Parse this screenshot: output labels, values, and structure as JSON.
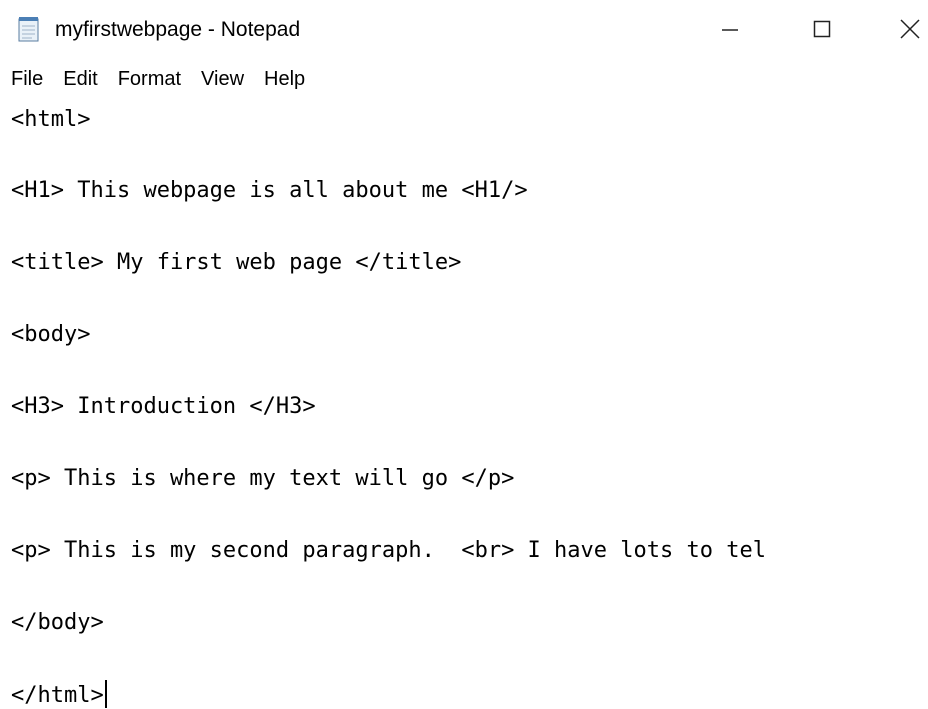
{
  "window": {
    "title": "myfirstwebpage - Notepad",
    "app_icon": "notepad-icon",
    "controls": {
      "minimize_icon": "minimize-icon",
      "maximize_icon": "maximize-icon",
      "close_icon": "close-icon"
    }
  },
  "menu": {
    "items": [
      {
        "label": "File"
      },
      {
        "label": "Edit"
      },
      {
        "label": "Format"
      },
      {
        "label": "View"
      },
      {
        "label": "Help"
      }
    ]
  },
  "editor": {
    "lines": [
      "<html>",
      "<H1> This webpage is all about me <H1/>",
      "<title> My first web page </title>",
      "<body>",
      "<H3> Introduction </H3>",
      "<p> This is where my text will go </p>",
      "<p> This is my second paragraph.  <br> I have lots to tel",
      "</body>",
      "</html>"
    ]
  }
}
